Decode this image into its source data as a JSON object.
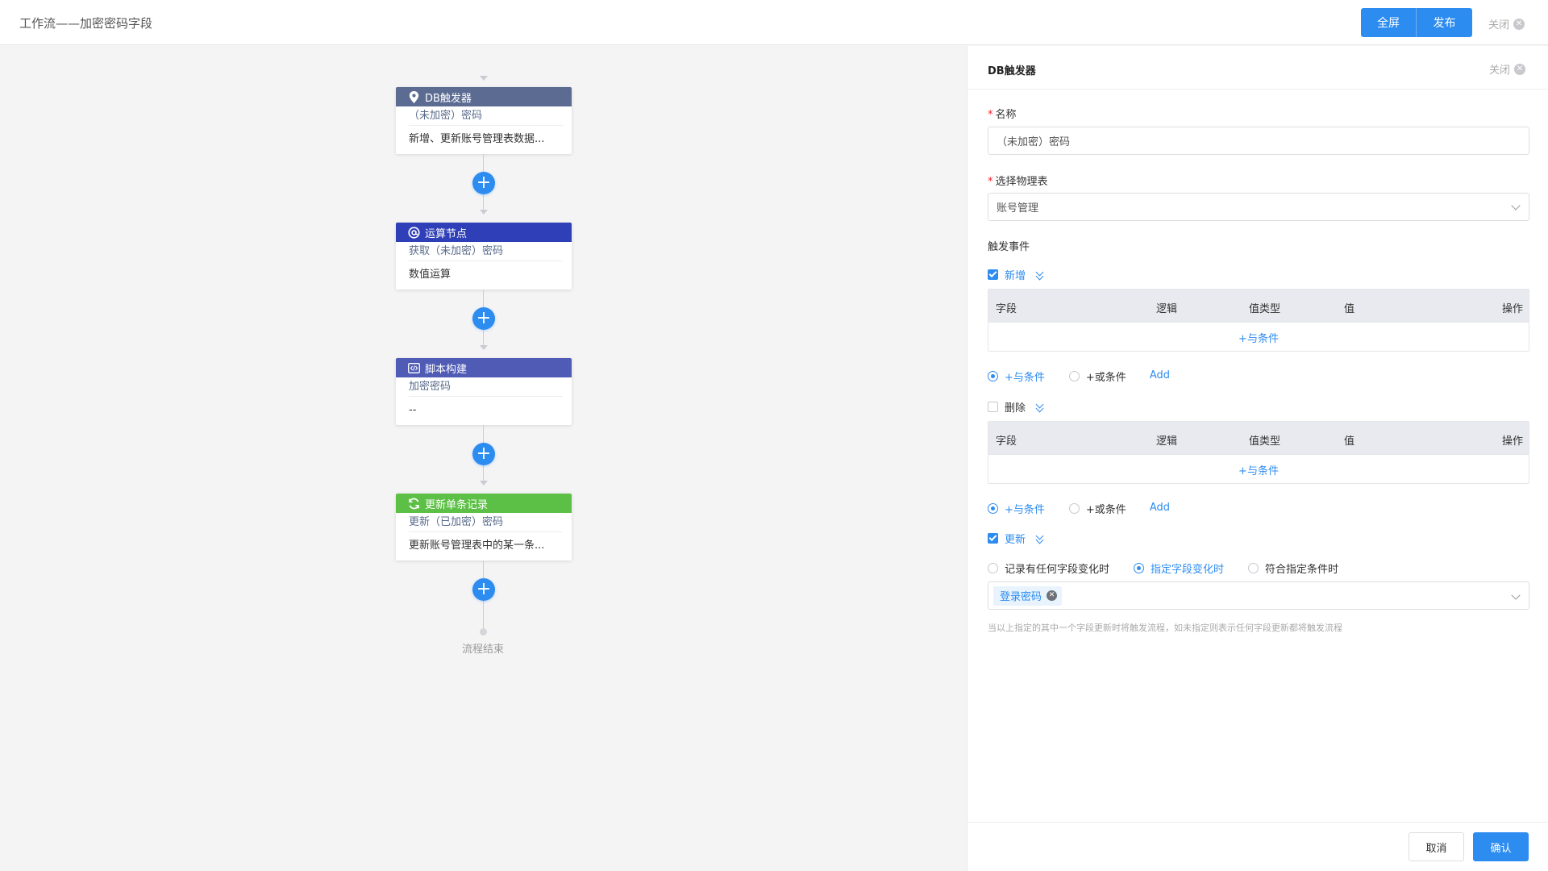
{
  "header": {
    "title": "工作流——加密密码字段",
    "fullscreen_label": "全屏",
    "publish_label": "发布",
    "close_label": "关闭"
  },
  "colors": {
    "primary": "#2d8cf0",
    "db_trigger": "#5b6b91",
    "compute": "#2f3fb7",
    "script": "#4f5bb5",
    "update": "#5dc046"
  },
  "flow": {
    "nodes": [
      {
        "icon": "location-pin-icon",
        "title": "DB触发器",
        "subtitle": "（未加密）密码",
        "desc": "新增、更新账号管理表数据..."
      },
      {
        "icon": "at-sign-icon",
        "title": "运算节点",
        "subtitle": "获取（未加密）密码",
        "desc": "数值运算"
      },
      {
        "icon": "code-icon",
        "title": "脚本构建",
        "subtitle": "加密密码",
        "desc": "--"
      },
      {
        "icon": "refresh-icon",
        "title": "更新单条记录",
        "subtitle": "更新（已加密）密码",
        "desc": "更新账号管理表中的某一条..."
      }
    ],
    "end_label": "流程结束"
  },
  "panel": {
    "title": "DB触发器",
    "close_label": "关闭",
    "name_label": "名称",
    "name_value": "（未加密）密码",
    "table_label": "选择物理表",
    "table_value": "账号管理",
    "events_label": "触发事件",
    "events": {
      "create": {
        "label": "新增",
        "checked": true
      },
      "delete": {
        "label": "删除",
        "checked": false
      },
      "update": {
        "label": "更新",
        "checked": true
      }
    },
    "condition_table": {
      "headers": [
        "字段",
        "逻辑",
        "值类型",
        "值",
        "操作"
      ],
      "add_and": "+与条件"
    },
    "condition_mode": {
      "and_label": "+与条件",
      "or_label": "+或条件",
      "add_label": "Add",
      "selected": "and"
    },
    "update_mode": {
      "options": [
        "记录有任何字段变化时",
        "指定字段变化时",
        "符合指定条件时"
      ],
      "selected": "指定字段变化时"
    },
    "fields_tag": "登录密码",
    "hint": "当以上指定的其中一个字段更新时将触发流程，如未指定则表示任何字段更新都将触发流程",
    "cancel_label": "取消",
    "confirm_label": "确认"
  }
}
